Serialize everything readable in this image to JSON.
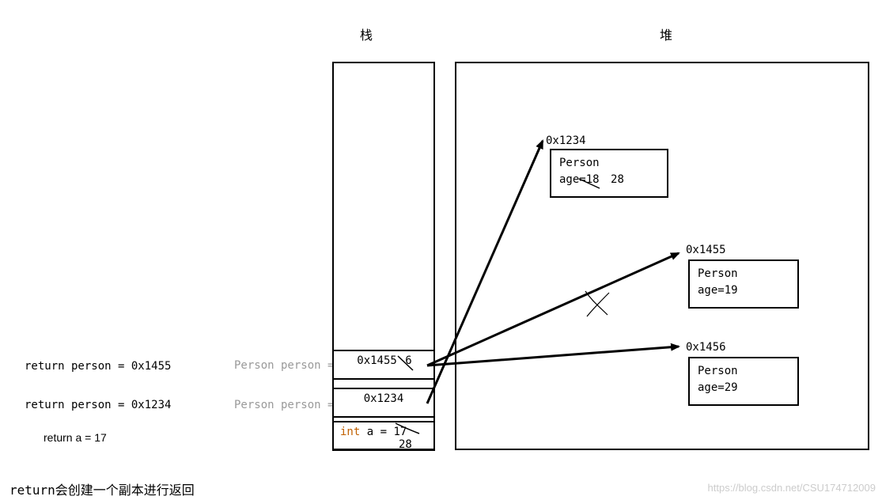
{
  "headers": {
    "stack": "栈",
    "heap": "堆"
  },
  "left_labels": {
    "return_person_1": "return person = 0x1455",
    "return_person_2": "return person = 0x1234",
    "return_a": "return a = 17"
  },
  "gray_labels": {
    "pp1": "Person person =",
    "pp2": "Person person ="
  },
  "stack_cells": {
    "cell1_main": "0x1455",
    "cell1_overwrite": "6",
    "cell2": "0x1234",
    "cell3_prefix": "int",
    "cell3_mid": " a = ",
    "cell3_old": "17",
    "cell3_new": "28"
  },
  "heap_objects": {
    "obj1_addr": "0x1234",
    "obj1_line1": "Person",
    "obj1_line2_prefix": "age=",
    "obj1_age_old": "18",
    "obj1_age_new": "28",
    "obj2_addr": "0x1455",
    "obj2_line1": "Person",
    "obj2_line2": "age=19",
    "obj3_addr": "0x1456",
    "obj3_line1": "Person",
    "obj3_line2": "age=29"
  },
  "footer": "return会创建一个副本进行返回",
  "watermark": "https://blog.csdn.net/CSU174712009"
}
